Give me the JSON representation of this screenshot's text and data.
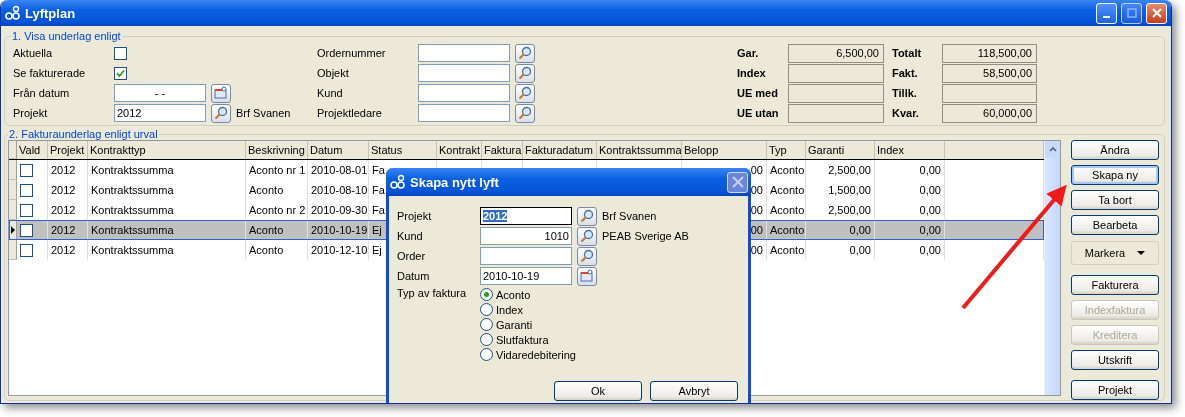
{
  "window": {
    "title": "Lyftplan"
  },
  "filter": {
    "heading": "1. Visa underlag enligt",
    "left": [
      {
        "kind": "checkbox",
        "label": "Aktuella",
        "checked": false
      },
      {
        "kind": "checkbox",
        "label": "Se fakturerade",
        "checked": true
      },
      {
        "kind": "date",
        "label": "Från datum",
        "value": "- -"
      },
      {
        "kind": "lookup",
        "label": "Projekt",
        "value": "2012",
        "name": "Brf Svanen"
      }
    ],
    "middle": [
      {
        "label": "Ordernummer"
      },
      {
        "label": "Objekt"
      },
      {
        "label": "Kund"
      },
      {
        "label": "Projektledare"
      }
    ],
    "totals_left": [
      {
        "label": "Gar.",
        "value": "6,500,00"
      },
      {
        "label": "Index"
      },
      {
        "label": "UE med"
      },
      {
        "label": "UE utan"
      }
    ],
    "totals_right": [
      {
        "label": "Totalt",
        "value": "118,500,00"
      },
      {
        "label": "Fakt.",
        "value": "58,500,00"
      },
      {
        "label": "Tillk."
      },
      {
        "label": "Kvar.",
        "value": "60,000,00"
      }
    ]
  },
  "table": {
    "heading": "2. Fakturaunderlag enligt urval",
    "columns": [
      "Vald",
      "Projekt",
      "Kontrakttyp",
      "Beskrivning",
      "Datum",
      "Status",
      "Kontrakt",
      "Faktura",
      "Fakturadatum",
      "Kontraktssumma",
      "Belopp",
      "Typ",
      "Garanti",
      "Index"
    ],
    "rows": [
      {
        "selected": false,
        "checked": false,
        "projekt": "2012",
        "kontrakttyp": "Kontraktssumma",
        "beskrivning": "Aconto nr 1",
        "datum": "2010-08-01",
        "status": "Fa",
        "belopp": "00",
        "typ": "Aconto",
        "garanti": "2,500,00",
        "index": "0,00"
      },
      {
        "selected": false,
        "checked": false,
        "projekt": "2012",
        "kontrakttyp": "Kontraktssumma",
        "beskrivning": "Aconto",
        "datum": "2010-08-10",
        "status": "Fa",
        "belopp": "00",
        "typ": "Aconto",
        "garanti": "1,500,00",
        "index": "0,00"
      },
      {
        "selected": false,
        "checked": false,
        "projekt": "2012",
        "kontrakttyp": "Kontraktssumma",
        "beskrivning": "Aconto nr 2",
        "datum": "2010-09-30",
        "status": "Fa",
        "belopp": "00",
        "typ": "Aconto",
        "garanti": "2,500,00",
        "index": "0,00"
      },
      {
        "selected": true,
        "checked": false,
        "projekt": "2012",
        "kontrakttyp": "Kontraktssumma",
        "beskrivning": "Aconto",
        "datum": "2010-10-19",
        "status": "Ej",
        "belopp": "00",
        "typ": "Aconto",
        "garanti": "0,00",
        "index": "0,00"
      },
      {
        "selected": false,
        "checked": false,
        "projekt": "2012",
        "kontrakttyp": "Kontraktssumma",
        "beskrivning": "Aconto",
        "datum": "2010-12-10",
        "status": "Ej",
        "belopp": "00",
        "typ": "Aconto",
        "garanti": "0,00",
        "index": "0,00"
      }
    ]
  },
  "actions": [
    {
      "kind": "button",
      "label": "Ändra",
      "disabled": false,
      "focused": false
    },
    {
      "kind": "button",
      "label": "Skapa ny",
      "disabled": false,
      "focused": true
    },
    {
      "kind": "button",
      "label": "Ta bort",
      "disabled": false,
      "focused": false
    },
    {
      "kind": "button",
      "label": "Bearbeta",
      "disabled": false,
      "focused": false
    },
    {
      "kind": "dropdown",
      "label": "Markera",
      "disabled": false,
      "focused": false
    },
    {
      "kind": "button",
      "label": "Fakturera",
      "disabled": false,
      "focused": false
    },
    {
      "kind": "button",
      "label": "Indexfaktura",
      "disabled": true,
      "focused": false
    },
    {
      "kind": "button",
      "label": "Kreditera",
      "disabled": true,
      "focused": false
    },
    {
      "kind": "button",
      "label": "Utskrift",
      "disabled": false,
      "focused": false
    },
    {
      "kind": "button",
      "label": "Projekt",
      "disabled": false,
      "focused": false
    }
  ],
  "dialog": {
    "title": "Skapa nytt lyft",
    "fields": [
      {
        "kind": "lookup",
        "label": "Projekt",
        "value": "2012",
        "highlighted": true,
        "name": "Brf Svanen"
      },
      {
        "kind": "number",
        "label": "Kund",
        "value": "1010",
        "highlighted": false,
        "name": "PEAB Sverige AB"
      },
      {
        "kind": "lookup",
        "label": "Order",
        "highlighted": false
      },
      {
        "kind": "date",
        "label": "Datum",
        "value": "2010-10-19",
        "highlighted": false
      }
    ],
    "type_label": "Typ av faktura",
    "options": [
      {
        "label": "Aconto",
        "selected": true
      },
      {
        "label": "Index",
        "selected": false
      },
      {
        "label": "Garanti",
        "selected": false
      },
      {
        "label": "Slutfaktura",
        "selected": false
      },
      {
        "label": "Vidaredebitering",
        "selected": false
      }
    ],
    "buttons": [
      "Ok",
      "Avbryt"
    ]
  }
}
